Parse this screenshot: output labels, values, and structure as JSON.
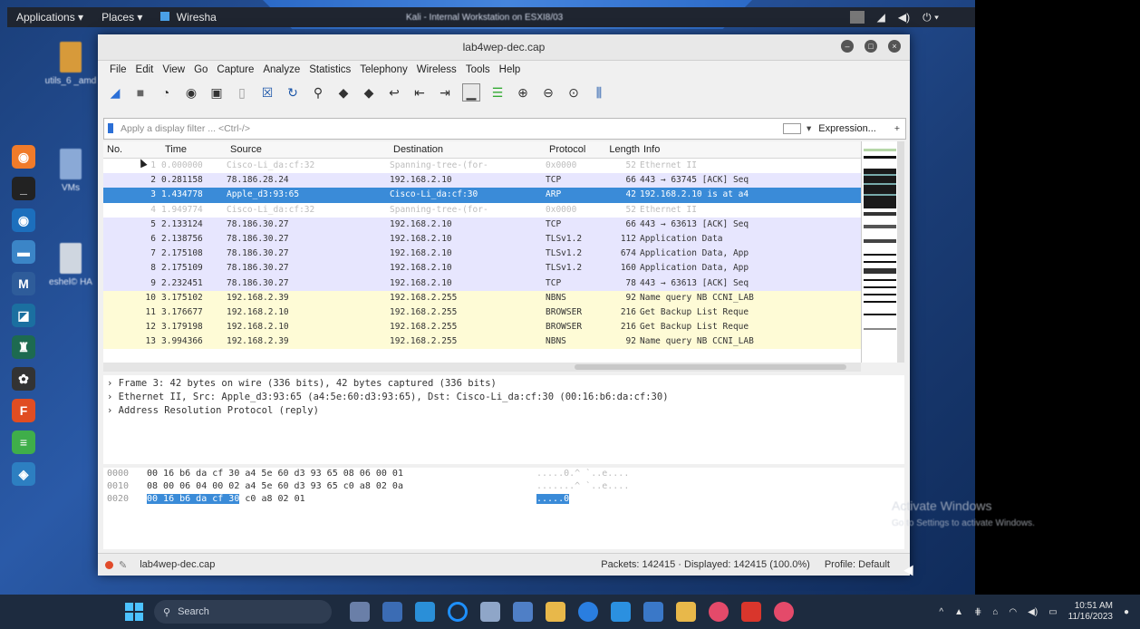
{
  "topbar": {
    "applications": "Applications ▾",
    "places": "Places ▾",
    "wireshark_tab": "Wiresha",
    "center_title": "Kali - Internal Workstation on ESXI8/03"
  },
  "desktop": {
    "icons": [
      {
        "label": "utils_6 _amd"
      },
      {
        "label": "VMs"
      },
      {
        "label": "eshel© HA"
      }
    ]
  },
  "window": {
    "title": "lab4wep-dec.cap",
    "menu": [
      "File",
      "Edit",
      "View",
      "Go",
      "Capture",
      "Analyze",
      "Statistics",
      "Telephony",
      "Wireless",
      "Tools",
      "Help"
    ],
    "filter_placeholder": "Apply a display filter ... <Ctrl-/>",
    "expression_label": "Expression...",
    "plus_label": "+"
  },
  "packet_list": {
    "headers": {
      "no": "No.",
      "time": "Time",
      "source": "Source",
      "destination": "Destination",
      "protocol": "Protocol",
      "length": "Length",
      "info": "Info"
    },
    "rows": [
      {
        "no": "1",
        "time": "0.000000",
        "src": "Cisco-Li_da:cf:32",
        "dst": "Spanning-tree-(for-",
        "proto": "0x0000",
        "len": "52",
        "info": "Ethernet II",
        "style": "stp"
      },
      {
        "no": "2",
        "time": "0.281158",
        "src": "78.186.28.24",
        "dst": "192.168.2.10",
        "proto": "TCP",
        "len": "66",
        "info": "443 → 63745 [ACK] Seq",
        "style": "tcp"
      },
      {
        "no": "3",
        "time": "1.434778",
        "src": "Apple_d3:93:65",
        "dst": "Cisco-Li_da:cf:30",
        "proto": "ARP",
        "len": "42",
        "info": "192.168.2.10 is at a4",
        "style": "sel"
      },
      {
        "no": "4",
        "time": "1.949774",
        "src": "Cisco-Li_da:cf:32",
        "dst": "Spanning-tree-(for-",
        "proto": "0x0000",
        "len": "52",
        "info": "Ethernet II",
        "style": "stp"
      },
      {
        "no": "5",
        "time": "2.133124",
        "src": "78.186.30.27",
        "dst": "192.168.2.10",
        "proto": "TCP",
        "len": "66",
        "info": "443 → 63613 [ACK] Seq",
        "style": "tcp"
      },
      {
        "no": "6",
        "time": "2.138756",
        "src": "78.186.30.27",
        "dst": "192.168.2.10",
        "proto": "TLSv1.2",
        "len": "112",
        "info": "Application Data",
        "style": "tcp"
      },
      {
        "no": "7",
        "time": "2.175108",
        "src": "78.186.30.27",
        "dst": "192.168.2.10",
        "proto": "TLSv1.2",
        "len": "674",
        "info": "Application Data, App",
        "style": "tcp"
      },
      {
        "no": "8",
        "time": "2.175109",
        "src": "78.186.30.27",
        "dst": "192.168.2.10",
        "proto": "TLSv1.2",
        "len": "160",
        "info": "Application Data, App",
        "style": "tcp"
      },
      {
        "no": "9",
        "time": "2.232451",
        "src": "78.186.30.27",
        "dst": "192.168.2.10",
        "proto": "TCP",
        "len": "78",
        "info": "443 → 63613 [ACK] Seq",
        "style": "tcp"
      },
      {
        "no": "10",
        "time": "3.175102",
        "src": "192.168.2.39",
        "dst": "192.168.2.255",
        "proto": "NBNS",
        "len": "92",
        "info": "Name query NB CCNI_LAB",
        "style": "nbns"
      },
      {
        "no": "11",
        "time": "3.176677",
        "src": "192.168.2.10",
        "dst": "192.168.2.255",
        "proto": "BROWSER",
        "len": "216",
        "info": "Get Backup List Reque",
        "style": "nbns"
      },
      {
        "no": "12",
        "time": "3.179198",
        "src": "192.168.2.10",
        "dst": "192.168.2.255",
        "proto": "BROWSER",
        "len": "216",
        "info": "Get Backup List Reque",
        "style": "nbns"
      },
      {
        "no": "13",
        "time": "3.994366",
        "src": "192.168.2.39",
        "dst": "192.168.2.255",
        "proto": "NBNS",
        "len": "92",
        "info": "Name query NB CCNI_LAB",
        "style": "nbns"
      }
    ]
  },
  "details": {
    "lines": [
      "› Frame 3: 42 bytes on wire (336 bits), 42 bytes captured (336 bits)",
      "› Ethernet II, Src: Apple_d3:93:65 (a4:5e:60:d3:93:65), Dst: Cisco-Li_da:cf:30 (00:16:b6:da:cf:30)",
      "› Address Resolution Protocol (reply)"
    ]
  },
  "bytes": {
    "lines": [
      {
        "off": "0000",
        "hex": "00 16 b6 da cf 30 a4 5e  60 d3 93 65 08 06 00 01",
        "hl": "",
        "rest": "",
        "ascii": ".....0.^ `..e....",
        "ascii_hl": ""
      },
      {
        "off": "0010",
        "hex": "08 00 06 04 00 02 a4 5e  60 d3 93 65 c0 a8 02 0a",
        "hl": "",
        "rest": "",
        "ascii": ".......^ `..e....",
        "ascii_hl": ""
      },
      {
        "off": "0020",
        "hex": "",
        "hl": "00 16 b6 da cf 30",
        "rest": " c0 a8  02 01",
        "ascii": "",
        "ascii_hl": ".....0"
      }
    ]
  },
  "status": {
    "file": "lab4wep-dec.cap",
    "packets": "Packets: 142415 · Displayed: 142415 (100.0%)",
    "profile": "Profile: Default"
  },
  "watermark": {
    "title": "Activate Windows",
    "sub": "Go to Settings to activate Windows."
  },
  "taskbar": {
    "search_label": "Search",
    "time": "10:51 AM",
    "date": "11/16/2023"
  },
  "colors": {
    "selected_row": "#3a8bd8",
    "tcp_row": "#e7e6fe",
    "nbns_row": "#fefbd6",
    "desktop_blue": "#2a5aa8"
  }
}
